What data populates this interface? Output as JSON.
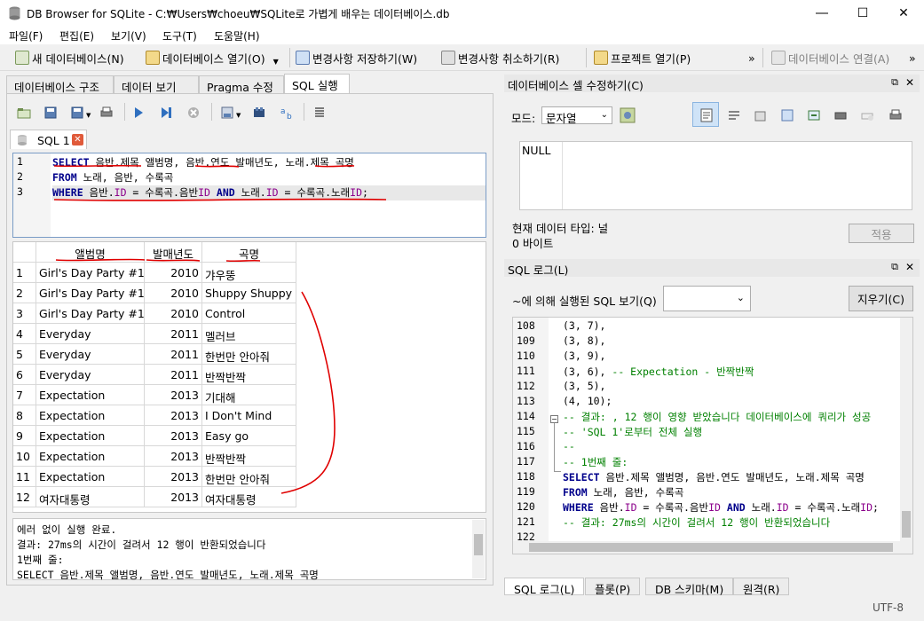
{
  "window": {
    "title": "DB Browser for SQLite - C:₩Users₩choeu₩SQLite로 가볍게 배우는 데이터베이스.db"
  },
  "menu": [
    "파일(F)",
    "편집(E)",
    "보기(V)",
    "도구(T)",
    "도움말(H)"
  ],
  "toolbar": {
    "new_db": "새 데이터베이스(N)",
    "open_db": "데이터베이스 열기(O)",
    "write": "변경사항 저장하기(W)",
    "revert": "변경사항 취소하기(R)",
    "open_project": "프로젝트 열기(P)",
    "more": "»",
    "attach": "데이터베이스 연결(A)",
    "more2": "»"
  },
  "main_tabs": [
    "데이터베이스 구조",
    "데이터 보기",
    "Pragma 수정",
    "SQL 실행"
  ],
  "sql_tab": {
    "label": "SQL 1"
  },
  "editor": {
    "line_numbers": [
      "1",
      "2",
      "3"
    ]
  },
  "result": {
    "columns": [
      "앨범명",
      "발매년도",
      "곡명"
    ],
    "rows": [
      [
        "1",
        "Girl's Day Party #1",
        "2010",
        "갸우뚱"
      ],
      [
        "2",
        "Girl's Day Party #1",
        "2010",
        "Shuppy Shuppy"
      ],
      [
        "3",
        "Girl's Day Party #1",
        "2010",
        "Control"
      ],
      [
        "4",
        "Everyday",
        "2011",
        "멜러브"
      ],
      [
        "5",
        "Everyday",
        "2011",
        "한번만 안아줘"
      ],
      [
        "6",
        "Everyday",
        "2011",
        "반짝반짝"
      ],
      [
        "7",
        "Expectation",
        "2013",
        "기대해"
      ],
      [
        "8",
        "Expectation",
        "2013",
        "I Don't Mind"
      ],
      [
        "9",
        "Expectation",
        "2013",
        "Easy go"
      ],
      [
        "10",
        "Expectation",
        "2013",
        "반짝반짝"
      ],
      [
        "11",
        "Expectation",
        "2013",
        "한번만 안아줘"
      ],
      [
        "12",
        "여자대통령",
        "2013",
        "여자대통령"
      ]
    ]
  },
  "messages": [
    "에러 없이 실행 완료.",
    "결과: 27ms의 시간이 걸려서 12 행이 반환되었습니다",
    "1번째 줄:",
    "SELECT 음반.제목 앨범명, 음반.연도 발매년도, 노래.제목 곡명"
  ],
  "edit_cell": {
    "title": "데이터베이스 셀 수정하기(C)",
    "mode_label": "모드:",
    "mode_value": "문자열",
    "cell_value": "NULL",
    "type_label": "현재 데이터 타입: 널",
    "size_label": "0 바이트",
    "apply": "적용"
  },
  "sql_log": {
    "title": "SQL 로그(L)",
    "show_label": "~에 의해 실행된 SQL 보기(Q)",
    "clear": "지우기(C)",
    "lines": [
      {
        "n": "108",
        "t": "(3, 7),",
        "c": ""
      },
      {
        "n": "109",
        "t": "(3, 8),",
        "c": ""
      },
      {
        "n": "110",
        "t": "(3, 9),",
        "c": ""
      },
      {
        "n": "111",
        "t": "(3, 6),  ",
        "c": "-- Expectation - 반짝반짝"
      },
      {
        "n": "112",
        "t": "(3, 5),",
        "c": ""
      },
      {
        "n": "113",
        "t": "(4, 10);",
        "c": ""
      },
      {
        "n": "114",
        "t": "",
        "c": "-- 결과: , 12 행이 영향 받았습니다 데이터베이스에 쿼리가 성공"
      },
      {
        "n": "115",
        "t": "",
        "c": "-- 'SQL 1'로부터 전체 실행"
      },
      {
        "n": "116",
        "t": "",
        "c": "--"
      },
      {
        "n": "117",
        "t": "",
        "c": "-- 1번째 줄:"
      },
      {
        "n": "118",
        "t": "",
        "c": ""
      },
      {
        "n": "119",
        "t": "",
        "c": ""
      },
      {
        "n": "120",
        "t": "",
        "c": ""
      },
      {
        "n": "121",
        "t": "",
        "c": "-- 결과: 27ms의 시간이 걸려서 12 행이 반환되었습니다"
      },
      {
        "n": "122",
        "t": "",
        "c": ""
      }
    ]
  },
  "bottom_tabs": [
    "SQL 로그(L)",
    "플롯(P)",
    "DB 스키마(M)",
    "원격(R)"
  ],
  "status": {
    "encoding": "UTF-8"
  }
}
